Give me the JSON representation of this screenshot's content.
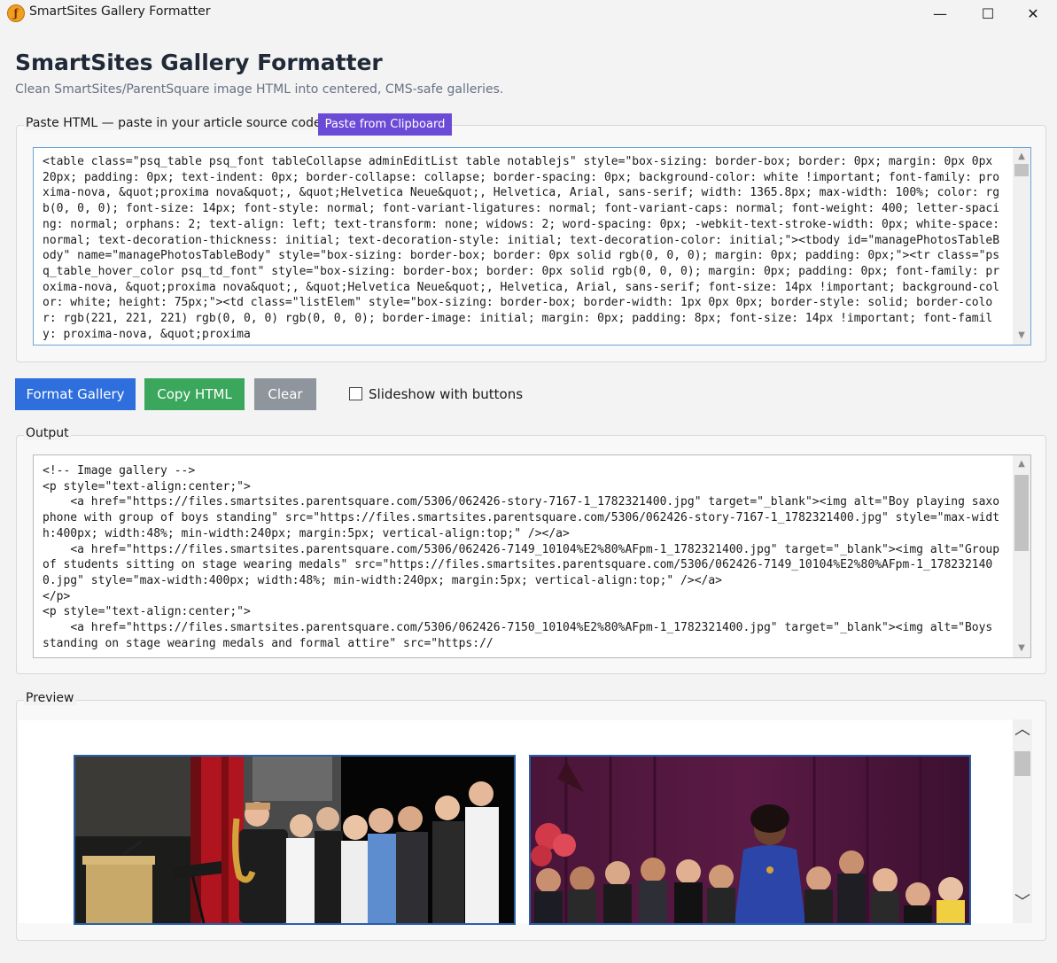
{
  "window": {
    "title": "SmartSites Gallery Formatter",
    "minimize_glyph": "—",
    "maximize_glyph": "☐",
    "close_glyph": "✕",
    "icon": "app-icon"
  },
  "header": {
    "title": "SmartSites Gallery Formatter",
    "subtitle": "Clean SmartSites/ParentSquare image HTML into centered, CMS-safe galleries."
  },
  "input_group": {
    "label": "Paste HTML — paste in your article source code",
    "paste_button": "Paste from Clipboard",
    "content": "<table class=\"psq_table psq_font tableCollapse adminEditList table notablejs\" style=\"box-sizing: border-box; border: 0px; margin: 0px 0px 20px; padding: 0px; text-indent: 0px; border-collapse: collapse; border-spacing: 0px; background-color: white !important; font-family: proxima-nova, &quot;proxima nova&quot;, &quot;Helvetica Neue&quot;, Helvetica, Arial, sans-serif; width: 1365.8px; max-width: 100%; color: rgb(0, 0, 0); font-size: 14px; font-style: normal; font-variant-ligatures: normal; font-variant-caps: normal; font-weight: 400; letter-spacing: normal; orphans: 2; text-align: left; text-transform: none; widows: 2; word-spacing: 0px; -webkit-text-stroke-width: 0px; white-space: normal; text-decoration-thickness: initial; text-decoration-style: initial; text-decoration-color: initial;\"><tbody id=\"managePhotosTableBody\" name=\"managePhotosTableBody\" style=\"box-sizing: border-box; border: 0px solid rgb(0, 0, 0); margin: 0px; padding: 0px;\"><tr class=\"psq_table_hover_color psq_td_font\" style=\"box-sizing: border-box; border: 0px solid rgb(0, 0, 0); margin: 0px; padding: 0px; font-family: proxima-nova, &quot;proxima nova&quot;, &quot;Helvetica Neue&quot;, Helvetica, Arial, sans-serif; font-size: 14px !important; background-color: white; height: 75px;\"><td class=\"listElem\" style=\"box-sizing: border-box; border-width: 1px 0px 0px; border-style: solid; border-color: rgb(221, 221, 221) rgb(0, 0, 0) rgb(0, 0, 0); border-image: initial; margin: 0px; padding: 8px; font-size: 14px !important; font-family: proxima-nova, &quot;proxima"
  },
  "actions": {
    "format": "Format Gallery",
    "copy": "Copy HTML",
    "clear": "Clear",
    "slideshow_label": "Slideshow with buttons",
    "slideshow_checked": false,
    "colors": {
      "format": "#2f6fdd",
      "copy": "#3aa75c",
      "clear": "#8e959c"
    }
  },
  "output_group": {
    "label": "Output",
    "content": "<!-- Image gallery -->\n<p style=\"text-align:center;\">\n    <a href=\"https://files.smartsites.parentsquare.com/5306/062426-story-7167-1_1782321400.jpg\" target=\"_blank\"><img alt=\"Boy playing saxophone with group of boys standing\" src=\"https://files.smartsites.parentsquare.com/5306/062426-story-7167-1_1782321400.jpg\" style=\"max-width:400px; width:48%; min-width:240px; margin:5px; vertical-align:top;\" /></a>\n    <a href=\"https://files.smartsites.parentsquare.com/5306/062426-7149_10104%E2%80%AFpm-1_1782321400.jpg\" target=\"_blank\"><img alt=\"Group of students sitting on stage wearing medals\" src=\"https://files.smartsites.parentsquare.com/5306/062426-7149_10104%E2%80%AFpm-1_1782321400.jpg\" style=\"max-width:400px; width:48%; min-width:240px; margin:5px; vertical-align:top;\" /></a>\n</p>\n<p style=\"text-align:center;\">\n    <a href=\"https://files.smartsites.parentsquare.com/5306/062426-7150_10104%E2%80%AFpm-1_1782321400.jpg\" target=\"_blank\"><img alt=\"Boys standing on stage wearing medals and formal attire\" src=\"https://"
  },
  "preview_group": {
    "label": "Preview"
  }
}
